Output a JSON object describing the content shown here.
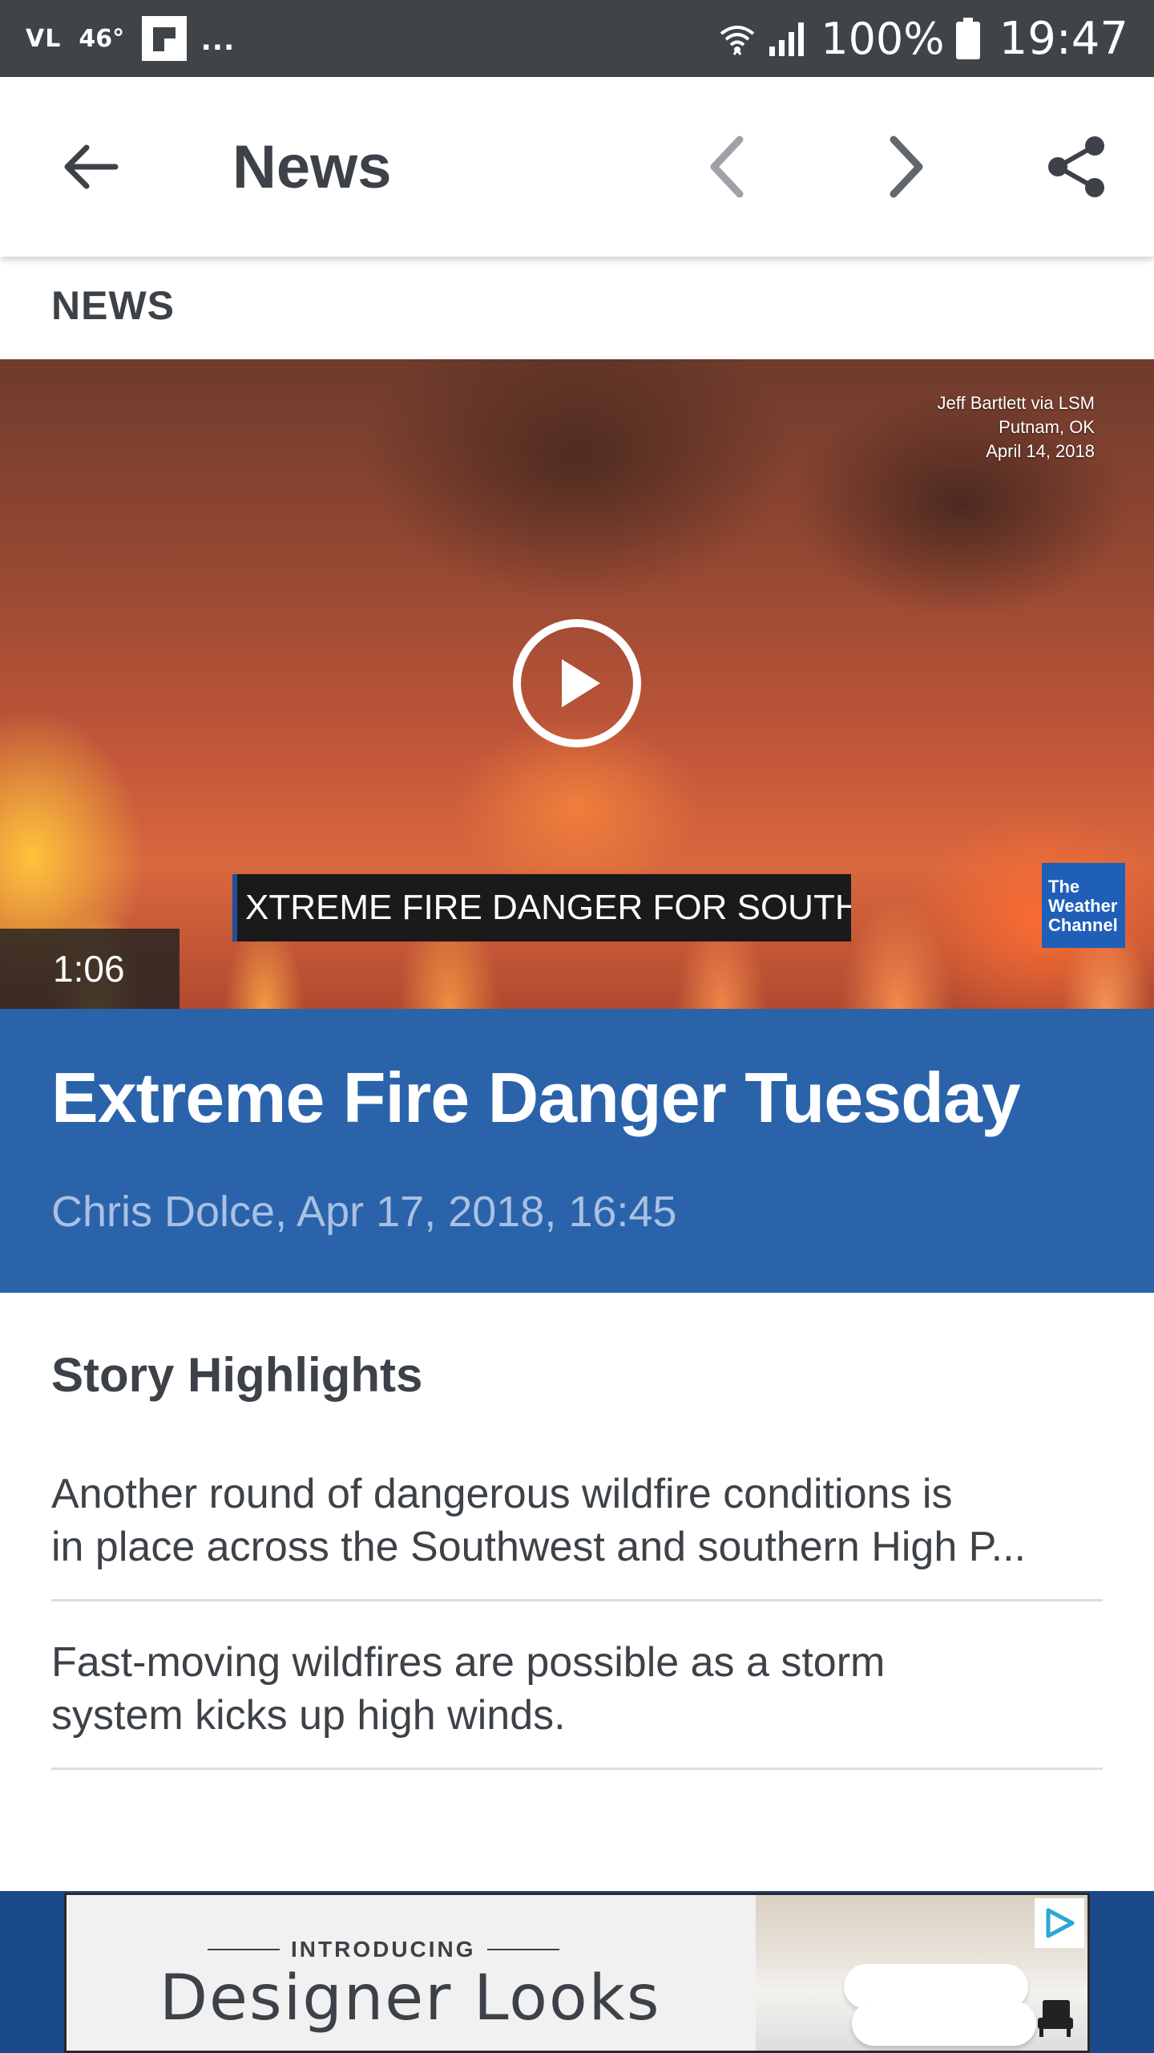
{
  "status_bar": {
    "carrier": "VL",
    "temperature": "46°",
    "more": "...",
    "battery": "100%",
    "time": "19:47"
  },
  "app_bar": {
    "title": "News"
  },
  "section_label": "NEWS",
  "video": {
    "credit_lines": [
      "Jeff Bartlett via LSM",
      "Putnam, OK",
      "April 14, 2018"
    ],
    "ticker": "XTREME FIRE DANGER FOR SOUTHW",
    "logo_lines": [
      "The",
      "Weather",
      "Channel"
    ],
    "duration": "1:06"
  },
  "article": {
    "headline": "Extreme Fire Danger Tuesday",
    "byline": "Chris Dolce, Apr 17, 2018, 16:45"
  },
  "highlights": {
    "title": "Story Highlights",
    "items": [
      {
        "line1": "Another round of dangerous wildfire conditions is",
        "line2": "in place across the Southwest and southern High P..."
      },
      {
        "line1": "Fast-moving wildfires are possible as a storm",
        "line2": "system kicks up high winds."
      }
    ]
  },
  "ad": {
    "intro": "INTRODUCING",
    "title": "Designer Looks"
  },
  "colors": {
    "status_bar": "#3f4448",
    "headline_card": "#2b63ab",
    "byline": "#a9c1e3",
    "text": "#3d4248",
    "ad_strip": "#1b4a8a"
  },
  "icons": {
    "back": "arrow-left-icon",
    "prev": "chevron-left-icon",
    "next": "chevron-right-icon",
    "share": "share-icon",
    "play": "play-icon",
    "wifi": "wifi-icon",
    "signal": "signal-icon",
    "battery": "battery-icon",
    "flipboard": "flipboard-icon",
    "ad_choices": "ad-choices-icon"
  }
}
